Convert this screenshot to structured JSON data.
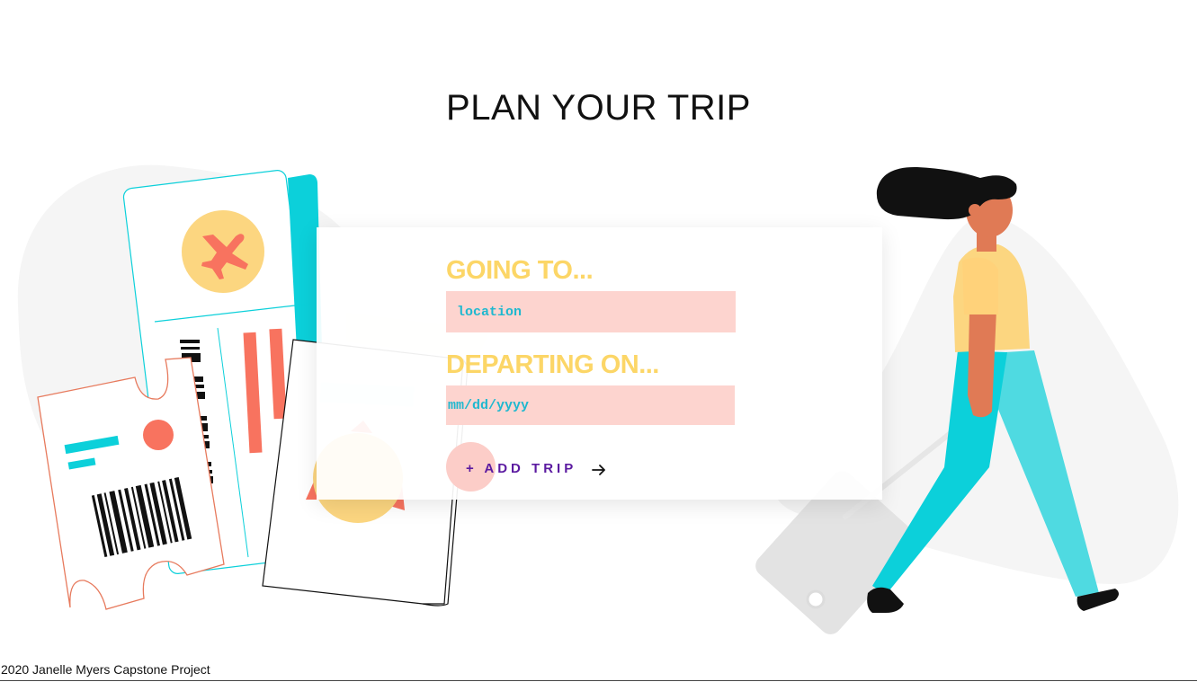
{
  "page": {
    "title": "PLAN YOUR TRIP"
  },
  "form": {
    "destination_label": "GOING TO...",
    "destination_placeholder": "location",
    "destination_value": "",
    "date_label": "DEPARTING ON...",
    "date_placeholder": "mm/dd/yyyy",
    "date_value": "",
    "submit_label": "+ ADD TRIP",
    "submit_icon": "arrow-right-icon"
  },
  "footer": {
    "text": "2020 Janelle Myers Capstone Project"
  },
  "colors": {
    "label_yellow": "#fcd667",
    "input_bg": "#fdd4cf",
    "input_text": "#1fb8cf",
    "button_text": "#5b1aa0",
    "button_circle": "#fccdc8",
    "teal": "#0cd0da",
    "coral": "#f8735f"
  },
  "illustrations": {
    "left": "travel-tickets-passport-illustration",
    "right": "woman-walking-with-suitcase-illustration"
  }
}
